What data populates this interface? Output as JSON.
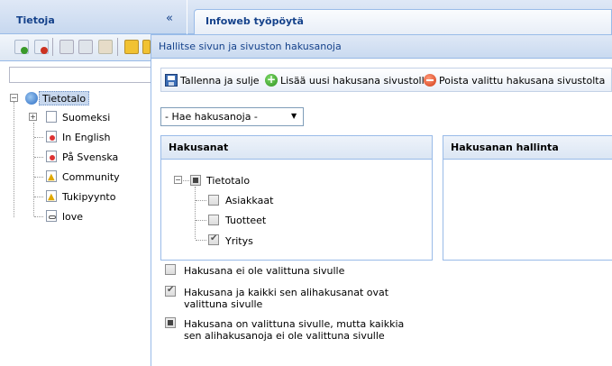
{
  "left_panel": {
    "title": "Tietoja",
    "collapse": "«",
    "tree": {
      "root": "Tietotalo",
      "items": [
        {
          "label": "Suomeksi",
          "icon": "page-icon"
        },
        {
          "label": "In English",
          "icon": "flag-page-icon"
        },
        {
          "label": "På Svenska",
          "icon": "flag-page-icon"
        },
        {
          "label": "Community",
          "icon": "warning-page-icon"
        },
        {
          "label": "Tukipyynto",
          "icon": "warning-page-icon"
        },
        {
          "label": "love",
          "icon": "link-page-icon"
        }
      ]
    }
  },
  "workspace_tab": {
    "title": "Infoweb työpöytä"
  },
  "dialog": {
    "title": "Hallitse sivun ja sivuston hakusanoja",
    "toolbar": {
      "save_label": "Tallenna ja sulje",
      "add_label": "Lisää uusi hakusana sivustolle",
      "remove_label": "Poista valittu hakusana sivustolta"
    },
    "search_select": {
      "value": "- Hae hakusanoja -"
    },
    "keywords_panel": {
      "title": "Hakusanat",
      "root": "Tietotalo",
      "children": [
        {
          "label": "Asiakkaat",
          "checked": false
        },
        {
          "label": "Tuotteet",
          "checked": false
        },
        {
          "label": "Yritys",
          "checked": true
        }
      ]
    },
    "manage_panel": {
      "title": "Hakusanan hallinta"
    },
    "legend": [
      {
        "state": "empty",
        "text": "Hakusana ei ole valittuna sivulle"
      },
      {
        "state": "checked",
        "text": "Hakusana ja kaikki sen alihakusanat ovat valittuna sivulle"
      },
      {
        "state": "partial",
        "text": "Hakusana on valittuna sivulle, mutta kaikkia sen alihakusanoja ei ole valittuna sivulle"
      }
    ]
  },
  "colors": {
    "header_text": "#15428b",
    "border": "#99bbe8"
  }
}
